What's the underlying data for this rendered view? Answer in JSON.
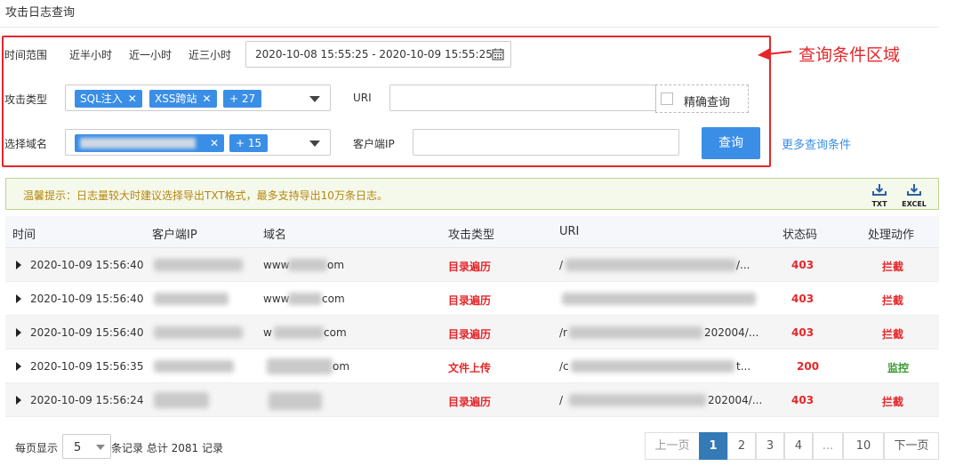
{
  "page": {
    "title": "攻击日志查询"
  },
  "annotation": {
    "text": "查询条件区域",
    "color": "#e5262a"
  },
  "filters": {
    "time_label": "时间范围",
    "quick_ranges": [
      "近半小时",
      "近一小时",
      "近三小时"
    ],
    "date_range": "2020-10-08 15:55:25 - 2020-10-09 15:55:25",
    "attack_type_label": "攻击类型",
    "attack_tags": [
      "SQL注入",
      "XSS跨站"
    ],
    "attack_more": "+ 27",
    "uri_label": "URI",
    "exact_label": "精确查询",
    "domain_label": "选择域名",
    "domain_more": "+ 15",
    "client_ip_label": "客户端IP",
    "query_button": "查询",
    "more_conditions": "更多查询条件"
  },
  "tip": {
    "text": "温馨提示：日志量较大时建议选择导出TXT格式，最多支持导出10万条日志。"
  },
  "exports": {
    "txt": "TXT",
    "excel": "EXCEL"
  },
  "table": {
    "headers": [
      "时间",
      "客户端IP",
      "域名",
      "攻击类型",
      "URI",
      "状态码",
      "处理动作"
    ],
    "rows": [
      {
        "time": "2020-10-09 15:56:40",
        "domain_a": "www",
        "domain_b": "om",
        "attack": "目录遍历",
        "uri_a": "/",
        "uri_b": "/...",
        "status": "403",
        "action": "拦截"
      },
      {
        "time": "2020-10-09 15:56:40",
        "domain_a": "www",
        "domain_b": "com",
        "attack": "目录遍历",
        "uri_a": "",
        "uri_b": "",
        "status": "403",
        "action": "拦截"
      },
      {
        "time": "2020-10-09 15:56:40",
        "domain_a": "w",
        "domain_b": "com",
        "attack": "目录遍历",
        "uri_a": "/r",
        "uri_b": "202004/...",
        "status": "403",
        "action": "拦截"
      },
      {
        "time": "2020-10-09 15:56:35",
        "domain_a": "",
        "domain_b": "om",
        "attack": "文件上传",
        "uri_a": "/c",
        "uri_b": "t...",
        "status": "200",
        "action": "监控"
      },
      {
        "time": "2020-10-09 15:56:24",
        "domain_a": "",
        "domain_b": "",
        "attack": "目录遍历",
        "uri_a": "/",
        "uri_b": "202004/...",
        "status": "403",
        "action": "拦截"
      }
    ]
  },
  "pagination": {
    "per_page_label": "每页显示",
    "page_size": "5",
    "summary": "条记录 总计 2081 记录",
    "prev": "上一页",
    "pages": [
      "1",
      "2",
      "3",
      "4",
      "...",
      "10"
    ],
    "next": "下一页",
    "current": "1"
  }
}
